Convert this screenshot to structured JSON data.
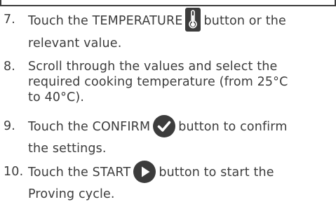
{
  "steps": [
    {
      "number": "7.",
      "before": "Touch the TEMPERATURE",
      "after": "button or the",
      "line2": "relevant value.",
      "icon": "thermometer-icon"
    },
    {
      "number": "8.",
      "line1": "Scroll through the values and select the",
      "line2": "required cooking temperature (from 25°C",
      "line3": "to 40°C)."
    },
    {
      "number": "9.",
      "before": "Touch the CONFIRM",
      "after": "button to confirm",
      "line2": "the settings.",
      "icon": "checkmark-circle-icon"
    },
    {
      "number": "10.",
      "before": "Touch the START",
      "after": "button to start the",
      "line2": "Proving cycle.",
      "icon": "play-icon"
    }
  ],
  "colors": {
    "text": "#3c3c3c",
    "icon_fill": "#3c3c3c",
    "icon_contrast": "#ffffff"
  }
}
